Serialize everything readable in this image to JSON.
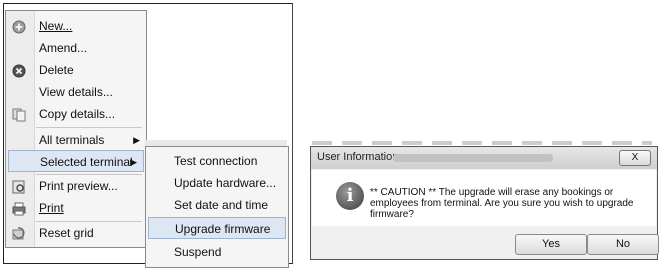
{
  "context_menu": {
    "items": [
      {
        "label": "New...",
        "icon": "plus-circle-icon"
      },
      {
        "label": "Amend..."
      },
      {
        "label": "Delete",
        "icon": "x-circle-icon"
      },
      {
        "label": "View details..."
      },
      {
        "label": "Copy details...",
        "icon": "copy-icon"
      },
      {
        "label": "All terminals"
      },
      {
        "label": "Selected terminal"
      },
      {
        "label": "Print preview...",
        "icon": "print-preview-icon"
      },
      {
        "label": "Print",
        "icon": "printer-icon"
      },
      {
        "label": "Reset grid",
        "icon": "reset-grid-icon"
      }
    ]
  },
  "sub_menu": {
    "items": [
      {
        "label": "Test connection"
      },
      {
        "label": "Update hardware..."
      },
      {
        "label": "Set date and time"
      },
      {
        "label": "Upgrade firmware"
      },
      {
        "label": "Suspend"
      }
    ]
  },
  "dialog": {
    "title": "User Information",
    "message": "** CAUTION ** The upgrade will erase any bookings or employees from terminal. Are you sure you wish to upgrade firmware?",
    "yes_label": "Yes",
    "no_label": "No",
    "close_label": "X",
    "info_glyph": "i"
  }
}
